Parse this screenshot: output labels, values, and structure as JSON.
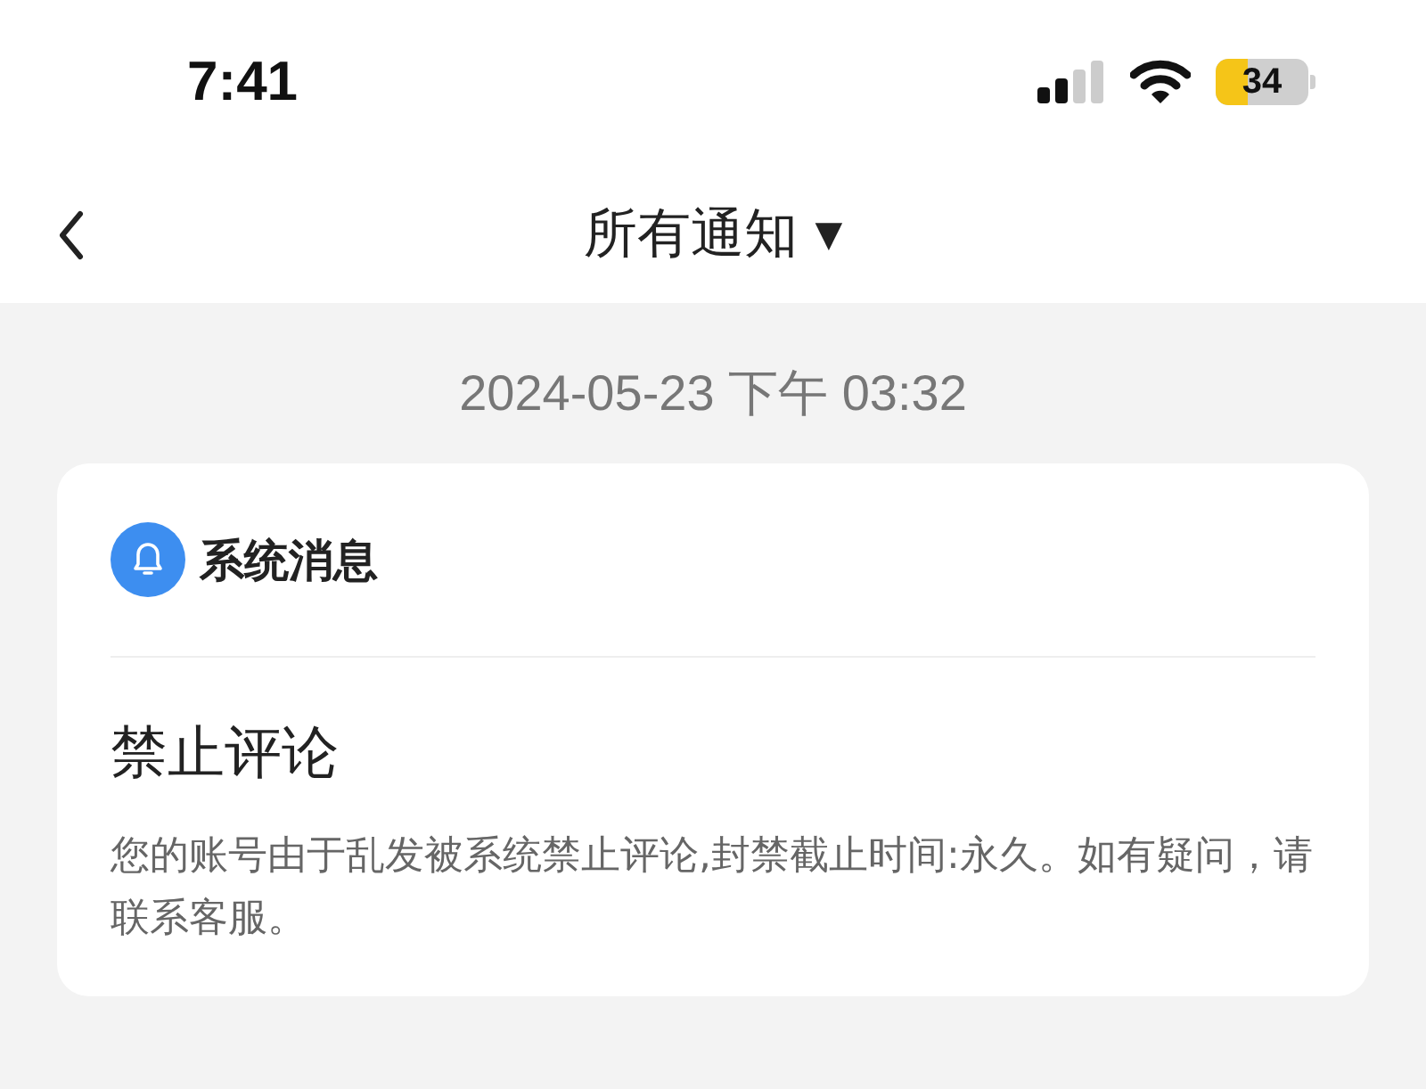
{
  "status_bar": {
    "time": "7:41",
    "battery": "34"
  },
  "header": {
    "title": "所有通知",
    "dropdown": "▼"
  },
  "messages": [
    {
      "timestamp": "2024-05-23  下午 03:32",
      "source": "系统消息",
      "title": "禁止评论",
      "body": "您的账号由于乱发被系统禁止评论,封禁截止时间:永久。如有疑问，请联系客服。"
    }
  ]
}
